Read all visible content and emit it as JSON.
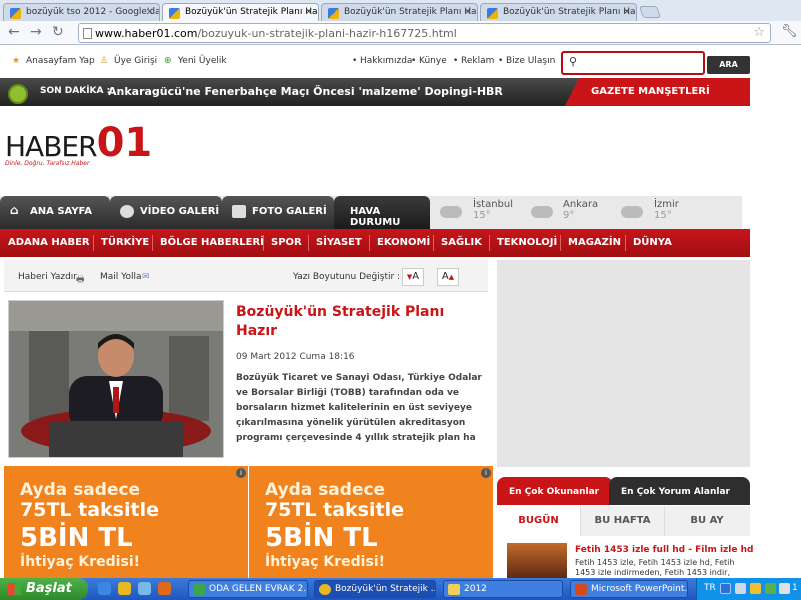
{
  "browser": {
    "tabs": [
      {
        "label": "bozüyük tso 2012 - Google'da",
        "active": false
      },
      {
        "label": "Bozüyük'ün Stratejik Planı Hazı",
        "active": true
      },
      {
        "label": "Bozüyük'ün Stratejik Planı Hazı",
        "active": false
      },
      {
        "label": "Bozüyük'ün Stratejik Planı Hazı",
        "active": false
      }
    ],
    "url_host": "www.haber01.com",
    "url_path": "/bozuyuk-un-stratejik-plani-hazir-h167725.html"
  },
  "site": {
    "toplinks": {
      "anasayfa": "Anasayfam Yap",
      "uye_girisi": "Üye Girişi",
      "yeni_uyelik": "Yeni Üyelik",
      "hakkimizda": "Hakkımızda",
      "kunye": "Künye",
      "reklam": "Reklam",
      "bize_ulasin": "Bize Ulaşın"
    },
    "search_button": "ARA",
    "breaking_label": "SON DAKİKA :",
    "breaking_text": "Ankaragücü'ne Fenerbahçe Maçı Öncesi 'malzeme' Dopingi-HBR",
    "gazete": "GAZETE MANŞETLERİ",
    "logo_main": "HABER",
    "logo_num": "01",
    "logo_slogan": "Dinle, Doğru, Tarafsız Haber",
    "mainnav": [
      "ANA SAYFA",
      "VİDEO GALERİ",
      "FOTO GALERİ",
      "HAVA DURUMU"
    ],
    "weather": [
      {
        "city": "İstanbul",
        "temp": "15°"
      },
      {
        "city": "Ankara",
        "temp": "9°"
      },
      {
        "city": "İzmir",
        "temp": "15°"
      }
    ],
    "categories": [
      "ADANA HABER",
      "TÜRKİYE",
      "BÖLGE HABERLERİ",
      "SPOR",
      "SİYASET",
      "EKONOMİ",
      "SAĞLIK",
      "TEKNOLOJİ",
      "MAGAZİN",
      "DÜNYA"
    ]
  },
  "article": {
    "print": "Haberi Yazdır",
    "mail": "Mail Yolla",
    "font_size_label": "Yazı Boyutunu Değiştir :",
    "font_dec": "A",
    "font_inc": "A",
    "headline": "Bozüyük'ün Stratejik Planı Hazır",
    "date": "09 Mart 2012 Cuma 18:16",
    "summary": "Bozüyük Ticaret ve Sanayi Odası, Türkiye Odalar ve Borsalar Birliği (TOBB) tarafından oda ve borsaların hizmet kalitelerinin en üst seviyeye çıkarılmasına yönelik yürütülen akreditasyon programı çerçevesinde 4 yıllık stratejik plan ha"
  },
  "ads": [
    {
      "l1": "Ayda sadece",
      "l2": "75TL taksitle",
      "l3": "5BİN TL",
      "l4": "İhtiyaç Kredisi!"
    },
    {
      "l1": "Ayda sadece",
      "l2": "75TL taksitle",
      "l3": "5BİN TL",
      "l4": "İhtiyaç Kredisi!"
    }
  ],
  "sidebar": {
    "tabs": [
      "En Çok Okunanlar",
      "En Çok Yorum Alanlar"
    ],
    "subtabs": [
      "BUGÜN",
      "BU HAFTA",
      "BU AY"
    ],
    "item_title": "Fetih 1453 izle full hd - Film izle hd",
    "item_text": "Fetih 1453 izle, Fetih 1453 izle hd, Fetih 1453 izle indirmeden, Fetih 1453 indir,"
  },
  "taskbar": {
    "start": "Başlat",
    "windows": [
      "ODA GELEN EVRAK 2...",
      "Bozüyük'ün Stratejik ...",
      "2012",
      "Microsoft PowerPoint..."
    ],
    "lang": "TR",
    "clock": "1"
  },
  "colors": {
    "brand_red": "#c91418",
    "ad_orange": "#f1831f",
    "taskbar_blue": "#2a63cf"
  }
}
